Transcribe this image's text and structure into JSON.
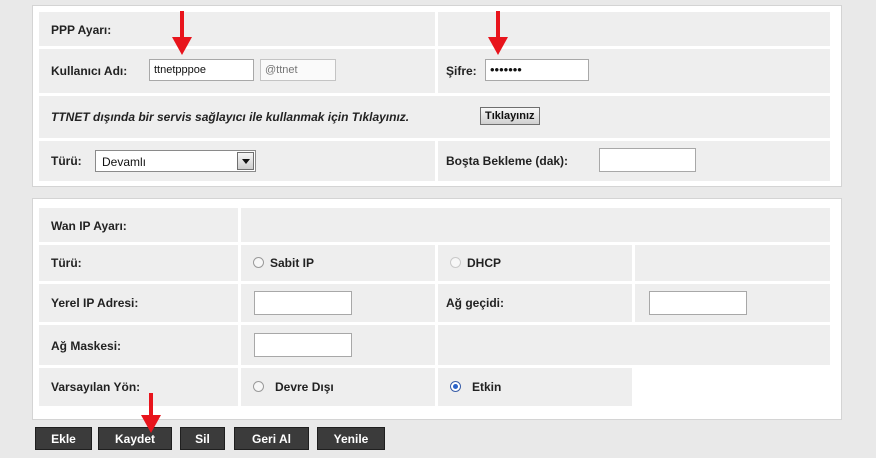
{
  "ppp": {
    "title": "PPP Ayarı:",
    "username_label": "Kullanıcı Adı:",
    "username_value": "ttnetpppoe",
    "domain_placeholder": "@ttnet",
    "password_label": "Şifre:",
    "password_mask": "•••••••",
    "other_provider_text": "TTNET dışında bir servis sağlayıcı ile kullanmak için Tıklayınız.",
    "click_button_label": "Tıklayınız",
    "type_label": "Türü:",
    "type_value": "Devamlı",
    "idle_label": "Boşta Bekleme (dak):",
    "idle_value": ""
  },
  "wan": {
    "title": "Wan IP Ayarı:",
    "type_label": "Türü:",
    "static_ip_label": "Sabit IP",
    "dhcp_label": "DHCP",
    "local_ip_label": "Yerel IP Adresi:",
    "gateway_label": "Ağ geçidi:",
    "netmask_label": "Ağ Maskesi:",
    "default_route_label": "Varsayılan Yön:",
    "disabled_label": "Devre Dışı",
    "enabled_label": "Etkin",
    "default_route_selected": "Etkin"
  },
  "actions": {
    "add": "Ekle",
    "save": "Kaydet",
    "delete": "Sil",
    "undo": "Geri Al",
    "refresh": "Yenile"
  },
  "colors": {
    "annotation_arrow": "#e8141c",
    "action_button": "#3b3b3b",
    "row_background": "#eeeeee"
  }
}
